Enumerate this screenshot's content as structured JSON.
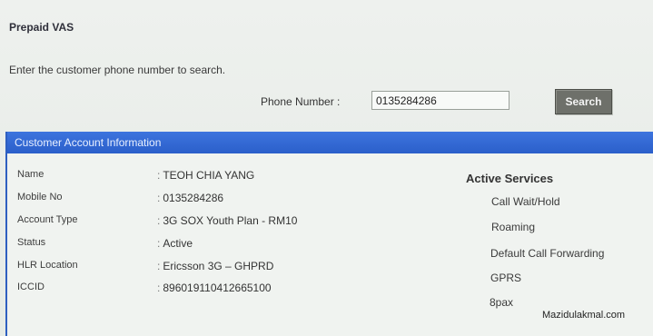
{
  "page": {
    "title": "Prepaid VAS",
    "instruction": "Enter the customer phone number to search."
  },
  "search": {
    "label": "Phone Number :",
    "value": "0135284286",
    "button_label": "Search"
  },
  "account": {
    "header": "Customer Account Information",
    "fields": [
      {
        "label": "Name",
        "value": "TEOH CHIA YANG"
      },
      {
        "label": "Mobile No",
        "value": "0135284286"
      },
      {
        "label": "Account Type",
        "value": "3G SOX Youth Plan - RM10"
      },
      {
        "label": "Status",
        "value": "Active"
      },
      {
        "label": "HLR Location",
        "value": "Ericsson 3G – GHPRD"
      },
      {
        "label": "ICCID",
        "value": "896019110412665100"
      }
    ],
    "active_services": {
      "title": "Active Services",
      "items": [
        "Call Wait/Hold",
        "Roaming",
        "Default Call Forwarding",
        "GPRS",
        "8pax"
      ]
    }
  },
  "watermark": "Mazidulakmal.com",
  "colors": {
    "header_blue": "#2e5fc0",
    "button_gray": "#6e706a",
    "background": "#ecf0ec"
  }
}
